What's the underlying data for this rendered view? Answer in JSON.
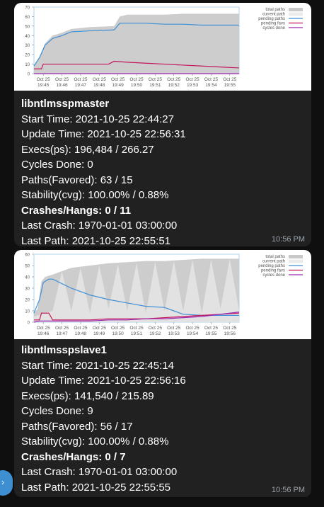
{
  "avatar_glyph": "›",
  "messages": [
    {
      "name": "libntlmsspmaster",
      "lines": [
        {
          "label": "Start Time:",
          "value": "2021-10-25 22:44:27",
          "bold": false
        },
        {
          "label": "Update Time:",
          "value": "2021-10-25 22:56:31",
          "bold": false
        },
        {
          "label": "Execs(ps):",
          "value": "196,484 / 266.27",
          "bold": false
        },
        {
          "label": "Cycles Done:",
          "value": "0",
          "bold": false
        },
        {
          "label": "Paths(Favored):",
          "value": "63 / 15",
          "bold": false
        },
        {
          "label": "Stability(cvg):",
          "value": "100.00% / 0.88%",
          "bold": false
        },
        {
          "label": "Crashes/Hangs:",
          "value": "0 / 11",
          "bold": true
        },
        {
          "label": "Last Crash:",
          "value": "1970-01-01 03:00:00",
          "bold": false
        },
        {
          "label": "Last Path:",
          "value": "2021-10-25 22:55:51",
          "bold": false
        }
      ],
      "time": "10:56 PM",
      "chart_data": {
        "type": "line",
        "y_ticks": [
          "0",
          "10",
          "20",
          "30",
          "40",
          "50",
          "60",
          "70"
        ],
        "ylim": [
          0,
          70
        ],
        "x_ticks": [
          {
            "date": "Oct 25",
            "time": "19:45"
          },
          {
            "date": "Oct 25",
            "time": "19:46"
          },
          {
            "date": "Oct 25",
            "time": "19:47"
          },
          {
            "date": "Oct 25",
            "time": "19:48"
          },
          {
            "date": "Oct 25",
            "time": "19:49"
          },
          {
            "date": "Oct 25",
            "time": "19:50"
          },
          {
            "date": "Oct 25",
            "time": "19:51"
          },
          {
            "date": "Oct 25",
            "time": "19:52"
          },
          {
            "date": "Oct 25",
            "time": "19:53"
          },
          {
            "date": "Oct 25",
            "time": "19:54"
          },
          {
            "date": "Oct 25",
            "time": "19:55"
          }
        ],
        "xlim": [
          0,
          11
        ],
        "legend": [
          {
            "name": "total paths",
            "color": "#c8c8c8"
          },
          {
            "name": "current path",
            "color": "#ebebeb"
          },
          {
            "name": "pending paths",
            "color": "#3f8fd6"
          },
          {
            "name": "pending favs",
            "color": "#c2185b"
          },
          {
            "name": "cycles done",
            "color": "#9c27b0"
          }
        ],
        "legend_position": "top-right",
        "series": [
          {
            "name": "total paths",
            "x": [
              0,
              0.3,
              0.6,
              1,
              1.5,
              2,
              3,
              4.3,
              4.6,
              5,
              6,
              7,
              8,
              9,
              10,
              11
            ],
            "y": [
              8,
              18,
              32,
              40,
              43,
              47,
              49,
              50,
              60,
              62,
              62,
              62,
              63,
              63,
              63,
              63
            ]
          },
          {
            "name": "pending paths",
            "x": [
              0,
              0.3,
              0.6,
              1,
              1.5,
              2,
              3,
              4.3,
              4.6,
              5,
              6,
              7,
              8,
              9,
              10,
              11
            ],
            "y": [
              8,
              17,
              30,
              37,
              40,
              44,
              45,
              46,
              53,
              53,
              53,
              52,
              52,
              51,
              51,
              51
            ]
          },
          {
            "name": "pending favs",
            "x": [
              0,
              0.4,
              0.5,
              1,
              2,
              3,
              4,
              4.3,
              5,
              6,
              7,
              8,
              9,
              10,
              11
            ],
            "y": [
              5,
              5,
              10,
              10,
              10,
              10,
              10,
              13,
              12,
              11,
              10,
              9,
              8,
              7,
              6
            ]
          },
          {
            "name": "cycles done",
            "x": [
              0,
              11
            ],
            "y": [
              0,
              0
            ]
          }
        ]
      }
    },
    {
      "name": "libntlmsspslave1",
      "lines": [
        {
          "label": "Start Time:",
          "value": "2021-10-25 22:45:14",
          "bold": false
        },
        {
          "label": "Update Time:",
          "value": "2021-10-25 22:56:16",
          "bold": false
        },
        {
          "label": "Execs(ps):",
          "value": "141,540 / 215.89",
          "bold": false
        },
        {
          "label": "Cycles Done:",
          "value": "9",
          "bold": false
        },
        {
          "label": "Paths(Favored):",
          "value": "56 / 17",
          "bold": false
        },
        {
          "label": "Stability(cvg):",
          "value": "100.00% / 0.88%",
          "bold": false
        },
        {
          "label": "Crashes/Hangs:",
          "value": "0 / 7",
          "bold": true
        },
        {
          "label": "Last Crash:",
          "value": "1970-01-01 03:00:00",
          "bold": false
        },
        {
          "label": "Last Path:",
          "value": "2021-10-25 22:55:55",
          "bold": false
        }
      ],
      "time": "10:56 PM",
      "chart_data": {
        "type": "line",
        "y_ticks": [
          "0",
          "10",
          "20",
          "30",
          "40",
          "50",
          "60"
        ],
        "ylim": [
          0,
          60
        ],
        "x_ticks": [
          {
            "date": "Oct 25",
            "time": "19:46"
          },
          {
            "date": "Oct 25",
            "time": "19:47"
          },
          {
            "date": "Oct 25",
            "time": "19:48"
          },
          {
            "date": "Oct 25",
            "time": "19:49"
          },
          {
            "date": "Oct 25",
            "time": "19:50"
          },
          {
            "date": "Oct 25",
            "time": "19:51"
          },
          {
            "date": "Oct 25",
            "time": "19:52"
          },
          {
            "date": "Oct 25",
            "time": "19:53"
          },
          {
            "date": "Oct 25",
            "time": "19:54"
          },
          {
            "date": "Oct 25",
            "time": "19:55"
          },
          {
            "date": "Oct 25",
            "time": "19:56"
          }
        ],
        "xlim": [
          0,
          11
        ],
        "legend": [
          {
            "name": "total paths",
            "color": "#c8c8c8"
          },
          {
            "name": "current path",
            "color": "#ebebeb"
          },
          {
            "name": "pending paths",
            "color": "#3f8fd6"
          },
          {
            "name": "pending favs",
            "color": "#c2185b"
          },
          {
            "name": "cycles done",
            "color": "#9c27b0"
          }
        ],
        "legend_position": "top-right",
        "series": [
          {
            "name": "total paths",
            "x": [
              0,
              0.2,
              0.4,
              0.6,
              1,
              1.5,
              2,
              3,
              4,
              5,
              6,
              7,
              8,
              9,
              10,
              11
            ],
            "y": [
              8,
              12,
              36,
              40,
              42,
              45,
              48,
              50,
              52,
              53,
              54,
              54,
              55,
              56,
              56,
              56
            ]
          },
          {
            "name": "current path",
            "x": [
              0,
              1,
              1.5,
              2,
              2.5,
              3,
              3.5,
              4,
              4.5,
              5,
              5.5,
              6,
              6.5,
              7,
              7.5,
              8,
              8.5,
              9,
              9.5,
              10,
              10.5,
              11
            ],
            "y": [
              5,
              10,
              45,
              10,
              48,
              8,
              50,
              12,
              51,
              10,
              52,
              8,
              53,
              10,
              54,
              10,
              55,
              8,
              55,
              12,
              56,
              10
            ]
          },
          {
            "name": "pending paths",
            "x": [
              0,
              0.3,
              0.5,
              0.8,
              1,
              1.5,
              2,
              3,
              4,
              5,
              6,
              7,
              7.5,
              8,
              9,
              10,
              11
            ],
            "y": [
              8,
              20,
              35,
              38,
              38,
              34,
              30,
              24,
              20,
              17,
              14,
              13,
              10,
              7,
              6,
              6,
              6
            ]
          },
          {
            "name": "pending favs",
            "x": [
              0,
              0.3,
              0.4,
              0.8,
              1,
              2,
              3,
              4,
              5,
              6,
              7,
              8,
              9,
              10,
              11
            ],
            "y": [
              2,
              2,
              8,
              8,
              2,
              2,
              2,
              3,
              3,
              3,
              4,
              5,
              6,
              7,
              8
            ]
          },
          {
            "name": "cycles done",
            "x": [
              0,
              0.3,
              1,
              2,
              3,
              4,
              5,
              6,
              7,
              8,
              9,
              10,
              11
            ],
            "y": [
              0,
              1,
              1,
              1,
              1,
              2,
              2,
              3,
              3,
              4,
              5,
              7,
              9
            ]
          }
        ]
      }
    }
  ]
}
